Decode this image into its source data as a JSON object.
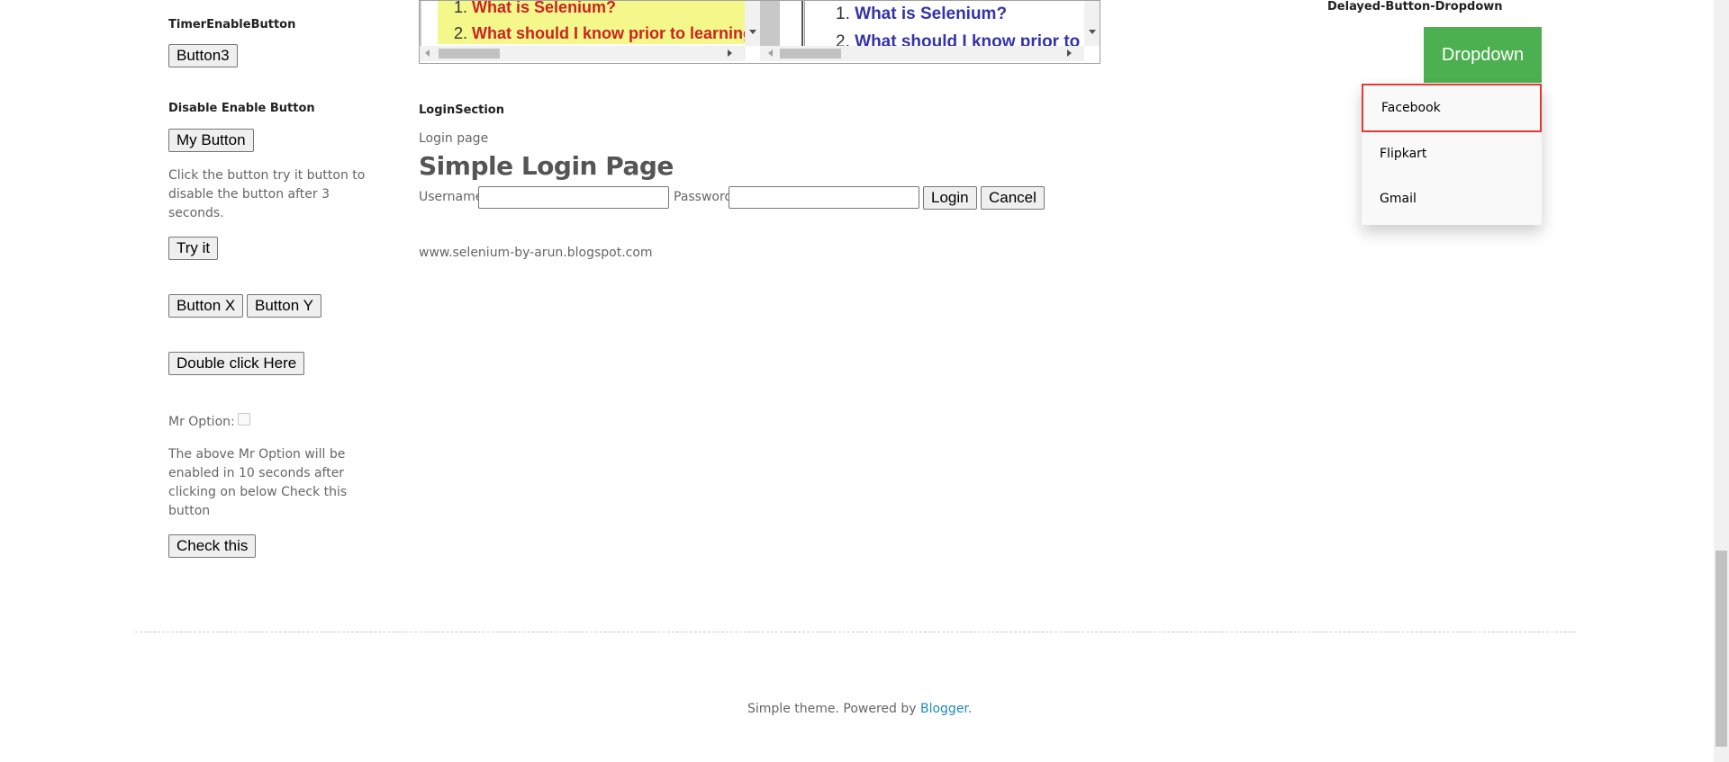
{
  "left": {
    "timer_heading": "TimerEnableButton",
    "button3": "Button3",
    "disable_heading": "Disable Enable Button",
    "my_button": "My Button",
    "click_text": "Click the button try it button to disable the button after 3 seconds.",
    "try_it": "Try it",
    "button_x": "Button X",
    "button_y": "Button Y",
    "double_click": "Double click Here",
    "mr_option_label": "Mr Option:",
    "above_text": "The above Mr Option will be enabled in 10 seconds after clicking on below Check this button",
    "check_this": "Check this"
  },
  "frames": {
    "yellow": {
      "items": [
        {
          "num": "1.",
          "text": "What is Selenium?"
        },
        {
          "num": "2.",
          "text": "What should I know prior to learning"
        }
      ],
      "color": "#cc2222",
      "bg": "#f4f78a"
    },
    "white": {
      "items": [
        {
          "num": "1.",
          "text": "What is Selenium?"
        },
        {
          "num": "2.",
          "text": "What should I know prior to"
        }
      ],
      "color": "#3333aa"
    }
  },
  "login": {
    "section_heading": "LoginSection",
    "login_page": "Login page",
    "title": "Simple Login Page",
    "username_label": "Username",
    "password_label": "Password",
    "login_button": "Login",
    "cancel_button": "Cancel",
    "site": "www.selenium-by-arun.blogspot.com"
  },
  "dropdown": {
    "heading": "Delayed-Button-Dropdown",
    "button": "Dropdown",
    "items": [
      "Facebook",
      "Flipkart",
      "Gmail"
    ],
    "accent": "#4caf50",
    "highlight": "#e53935"
  },
  "footer": {
    "prefix": "Simple theme. Powered by ",
    "link": "Blogger",
    "suffix": "."
  }
}
